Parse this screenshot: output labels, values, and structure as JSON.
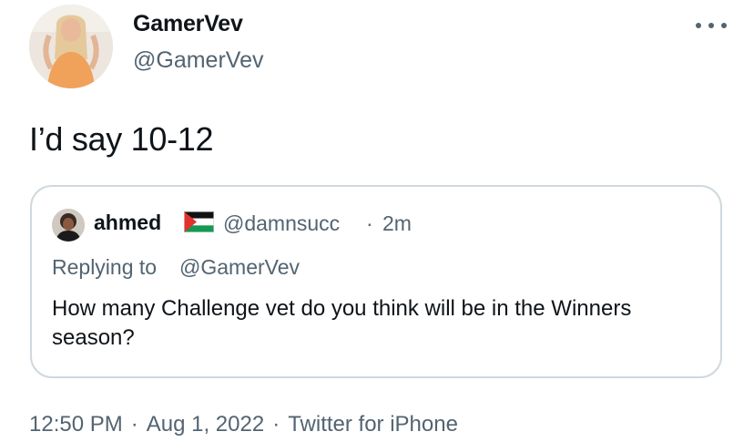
{
  "author": {
    "display_name": "GamerVev",
    "handle": "@GamerVev",
    "avatar_icon": "profile-photo"
  },
  "more_icon": "more-horizontal-icon",
  "tweet": {
    "text": "I’d say 10-12"
  },
  "quoted_tweet": {
    "display_name": "ahmed",
    "flag_icon": "palestine-flag-icon",
    "handle": "@damnsucc",
    "separator": "·",
    "time": "2m",
    "replying_prefix": "Replying to",
    "replying_handle": "@GamerVev",
    "body": "How many Challenge vet do you think will be in the Winners season?"
  },
  "meta": {
    "time": "12:50 PM",
    "separator": "·",
    "date": "Aug 1, 2022",
    "source": "Twitter for iPhone"
  },
  "colors": {
    "text": "#0f1419",
    "secondary": "#536471",
    "border": "#cfd9de"
  }
}
